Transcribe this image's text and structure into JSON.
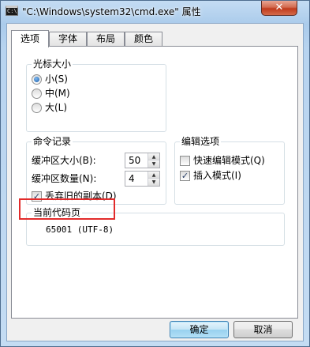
{
  "window": {
    "title": "\"C:\\Windows\\system32\\cmd.exe\" 属性",
    "icon": "cmd-console-icon",
    "close_glyph": "✕"
  },
  "tabs": [
    {
      "label": "选项",
      "active": true
    },
    {
      "label": "字体",
      "active": false
    },
    {
      "label": "布局",
      "active": false
    },
    {
      "label": "颜色",
      "active": false
    }
  ],
  "cursor_size": {
    "title": "光标大小",
    "options": [
      {
        "label": "小(S)",
        "selected": true
      },
      {
        "label": "中(M)",
        "selected": false
      },
      {
        "label": "大(L)",
        "selected": false
      }
    ]
  },
  "command_history": {
    "title": "命令记录",
    "buffer_size_label": "缓冲区大小(B):",
    "buffer_size_value": "50",
    "buffer_count_label": "缓冲区数量(N):",
    "buffer_count_value": "4",
    "discard_dup_label": "丢弃旧的副本(D)",
    "discard_dup_checked": true
  },
  "edit_options": {
    "title": "编辑选项",
    "items": [
      {
        "label": "快速编辑模式(Q)",
        "checked": false
      },
      {
        "label": "插入模式(I)",
        "checked": true
      }
    ]
  },
  "code_page": {
    "title": "当前代码页",
    "value": "65001 (UTF-8)",
    "highlight_color": "#e22b2b"
  },
  "buttons": {
    "ok": "确定",
    "cancel": "取消"
  }
}
